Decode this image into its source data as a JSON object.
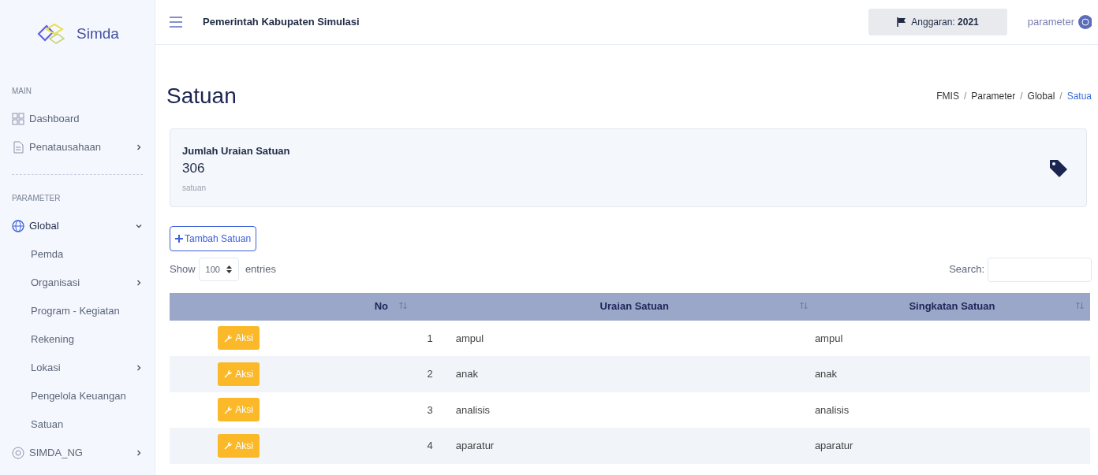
{
  "sidebar": {
    "logo": "Simda",
    "sections": [
      {
        "title": "MAIN",
        "items": [
          {
            "label": "Dashboard",
            "expanded": false,
            "has_submenu": false
          },
          {
            "label": "Penatausahaan",
            "expanded": false,
            "has_submenu": true
          }
        ]
      },
      {
        "title": "PARAMETER",
        "items": [
          {
            "label": "Global",
            "expanded": true,
            "has_submenu": true,
            "children": [
              {
                "label": "Pemda",
                "has_submenu": false
              },
              {
                "label": "Organisasi",
                "has_submenu": true
              },
              {
                "label": "Program - Kegiatan",
                "has_submenu": false
              },
              {
                "label": "Rekening",
                "has_submenu": false
              },
              {
                "label": "Lokasi",
                "has_submenu": true
              },
              {
                "label": "Pengelola Keuangan",
                "has_submenu": false
              },
              {
                "label": "Satuan",
                "has_submenu": false
              }
            ]
          },
          {
            "label": "SIMDA_NG",
            "expanded": false,
            "has_submenu": true
          }
        ]
      }
    ]
  },
  "header": {
    "title": "Pemerintah Kabupaten Simulasi",
    "budget_label": "Anggaran:",
    "budget_year": "2021",
    "user": "parameter"
  },
  "page": {
    "title": "Satuan",
    "breadcrumb": [
      {
        "label": "FMIS"
      },
      {
        "separator": "/",
        "label": "Parameter"
      },
      {
        "separator": "/",
        "label": "Global"
      },
      {
        "separator": "/",
        "label": "Satua"
      }
    ]
  },
  "summary": {
    "label": "Jumlah Uraian Satuan",
    "value": "306",
    "unit": "satuan"
  },
  "add_button": "Tambah Satuan",
  "table_controls": {
    "show_label": "Show",
    "page_size": "100",
    "entries_label": "entries",
    "search_label": "Search:"
  },
  "table": {
    "columns": [
      "",
      "No",
      "Uraian Satuan",
      "Singkatan Satuan"
    ],
    "rows": [
      {
        "action": "Aksi",
        "no": "1",
        "uraian": "ampul",
        "singkatan": "ampul"
      },
      {
        "action": "Aksi",
        "no": "2",
        "uraian": "anak",
        "singkatan": "anak"
      },
      {
        "action": "Aksi",
        "no": "3",
        "uraian": "analisis",
        "singkatan": "analisis"
      },
      {
        "action": "Aksi",
        "no": "4",
        "uraian": "aparatur",
        "singkatan": "aparatur"
      }
    ]
  }
}
